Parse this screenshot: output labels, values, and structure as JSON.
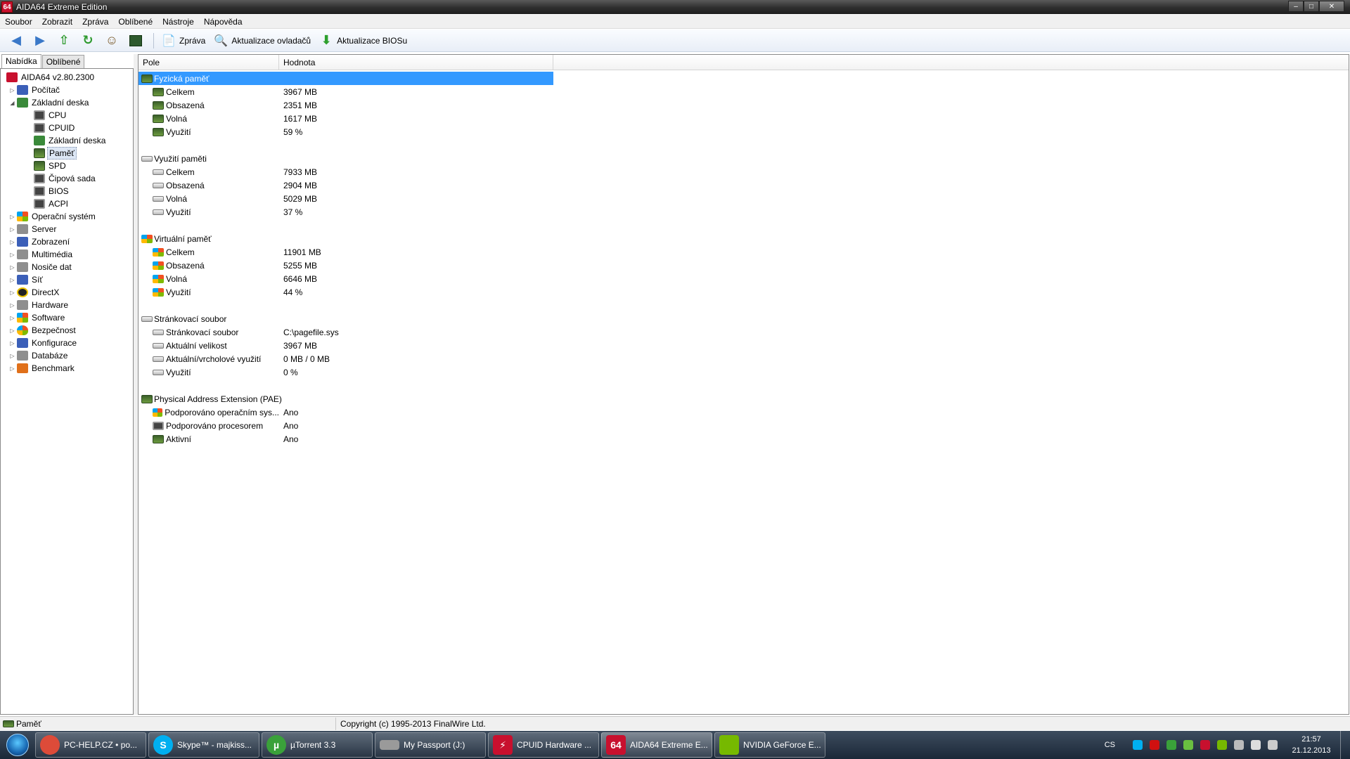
{
  "window": {
    "title": "AIDA64 Extreme Edition",
    "icon_text": "64"
  },
  "menu": [
    "Soubor",
    "Zobrazit",
    "Zpráva",
    "Oblíbené",
    "Nástroje",
    "Nápověda"
  ],
  "toolbar": {
    "report_label": "Zpráva",
    "driver_update_label": "Aktualizace ovladačů",
    "bios_update_label": "Aktualizace BIOSu"
  },
  "left_tabs": [
    "Nabídka",
    "Oblíbené"
  ],
  "tree": [
    {
      "label": "AIDA64 v2.80.2300",
      "icon": "aida-icon",
      "depth": 0
    },
    {
      "label": "Počítač",
      "icon": "computer-icon",
      "depth": 1
    },
    {
      "label": "Základní deska",
      "icon": "motherboard-icon",
      "depth": 1
    },
    {
      "label": "CPU",
      "icon": "cpu-icon",
      "depth": 2
    },
    {
      "label": "CPUID",
      "icon": "cpuid-icon",
      "depth": 2
    },
    {
      "label": "Základní deska",
      "icon": "motherboard-icon",
      "depth": 2
    },
    {
      "label": "Paměť",
      "icon": "memory-icon",
      "depth": 2
    },
    {
      "label": "SPD",
      "icon": "spd-icon",
      "depth": 2
    },
    {
      "label": "Čipová sada",
      "icon": "chipset-icon",
      "depth": 2
    },
    {
      "label": "BIOS",
      "icon": "bios-icon",
      "depth": 2
    },
    {
      "label": "ACPI",
      "icon": "acpi-icon",
      "depth": 2
    },
    {
      "label": "Operační systém",
      "icon": "windows-icon",
      "depth": 1
    },
    {
      "label": "Server",
      "icon": "server-icon",
      "depth": 1
    },
    {
      "label": "Zobrazení",
      "icon": "display-icon",
      "depth": 1
    },
    {
      "label": "Multimédia",
      "icon": "speaker-icon",
      "depth": 1
    },
    {
      "label": "Nosiče dat",
      "icon": "storage-icon",
      "depth": 1
    },
    {
      "label": "Síť",
      "icon": "network-icon",
      "depth": 1
    },
    {
      "label": "DirectX",
      "icon": "directx-icon",
      "depth": 1
    },
    {
      "label": "Hardware",
      "icon": "hardware-icon",
      "depth": 1
    },
    {
      "label": "Software",
      "icon": "software-icon",
      "depth": 1
    },
    {
      "label": "Bezpečnost",
      "icon": "security-icon",
      "depth": 1
    },
    {
      "label": "Konfigurace",
      "icon": "config-icon",
      "depth": 1
    },
    {
      "label": "Databáze",
      "icon": "database-icon",
      "depth": 1
    },
    {
      "label": "Benchmark",
      "icon": "benchmark-icon",
      "depth": 1
    }
  ],
  "columns": {
    "field": "Pole",
    "value": "Hodnota"
  },
  "groups": [
    {
      "title": "Fyzická paměť",
      "icon": "ram-icon",
      "selected": true,
      "items": [
        {
          "field": "Celkem",
          "value": "3967 MB"
        },
        {
          "field": "Obsazená",
          "value": "2351 MB"
        },
        {
          "field": "Volná",
          "value": "1617 MB"
        },
        {
          "field": "Využití",
          "value": "59 %"
        }
      ]
    },
    {
      "title": "Využití paměti",
      "icon": "drive-icon",
      "items": [
        {
          "field": "Celkem",
          "value": "7933 MB"
        },
        {
          "field": "Obsazená",
          "value": "2904 MB"
        },
        {
          "field": "Volná",
          "value": "5029 MB"
        },
        {
          "field": "Využití",
          "value": "37 %"
        }
      ]
    },
    {
      "title": "Virtuální paměť",
      "icon": "windows-icon",
      "items": [
        {
          "field": "Celkem",
          "value": "11901 MB"
        },
        {
          "field": "Obsazená",
          "value": "5255 MB"
        },
        {
          "field": "Volná",
          "value": "6646 MB"
        },
        {
          "field": "Využití",
          "value": "44 %"
        }
      ]
    },
    {
      "title": "Stránkovací soubor",
      "icon": "drive-icon",
      "items": [
        {
          "field": "Stránkovací soubor",
          "value": "C:\\pagefile.sys"
        },
        {
          "field": "Aktuální velikost",
          "value": "3967 MB"
        },
        {
          "field": "Aktuální/vrcholové využití",
          "value": "0 MB / 0 MB"
        },
        {
          "field": "Využití",
          "value": "0 %"
        }
      ]
    },
    {
      "title": "Physical Address Extension (PAE)",
      "icon": "ram-icon",
      "items": [
        {
          "field": "Podporováno operačním sys...",
          "value": "Ano",
          "icon": "windows-icon"
        },
        {
          "field": "Podporováno procesorem",
          "value": "Ano",
          "icon": "cpu-icon"
        },
        {
          "field": "Aktivní",
          "value": "Ano",
          "icon": "ram-icon"
        }
      ]
    }
  ],
  "status": {
    "left": "Paměť",
    "right": "Copyright (c) 1995-2013 FinalWire Ltd."
  },
  "taskbar": [
    {
      "label": "PC-HELP.CZ • po...",
      "icon": "chrome-icon",
      "color": "#dd4b39"
    },
    {
      "label": "Skype™ - majkiss...",
      "icon": "skype-icon",
      "color": "#00aff0"
    },
    {
      "label": "µTorrent 3.3",
      "icon": "utorrent-icon",
      "color": "#3aa13a"
    },
    {
      "label": "My Passport (J:)",
      "icon": "drive-icon",
      "color": "#9a9a9a"
    },
    {
      "label": "CPUID Hardware ...",
      "icon": "cpuid-hwmonitor-icon",
      "color": "#c8102e"
    },
    {
      "label": "AIDA64 Extreme E...",
      "icon": "aida-icon",
      "color": "#c8102e",
      "active": true
    },
    {
      "label": "NVIDIA GeForce E...",
      "icon": "nvidia-icon",
      "color": "#76b900"
    }
  ],
  "tray": {
    "language": "CS",
    "time": "21:57",
    "date": "21.12.2013"
  }
}
